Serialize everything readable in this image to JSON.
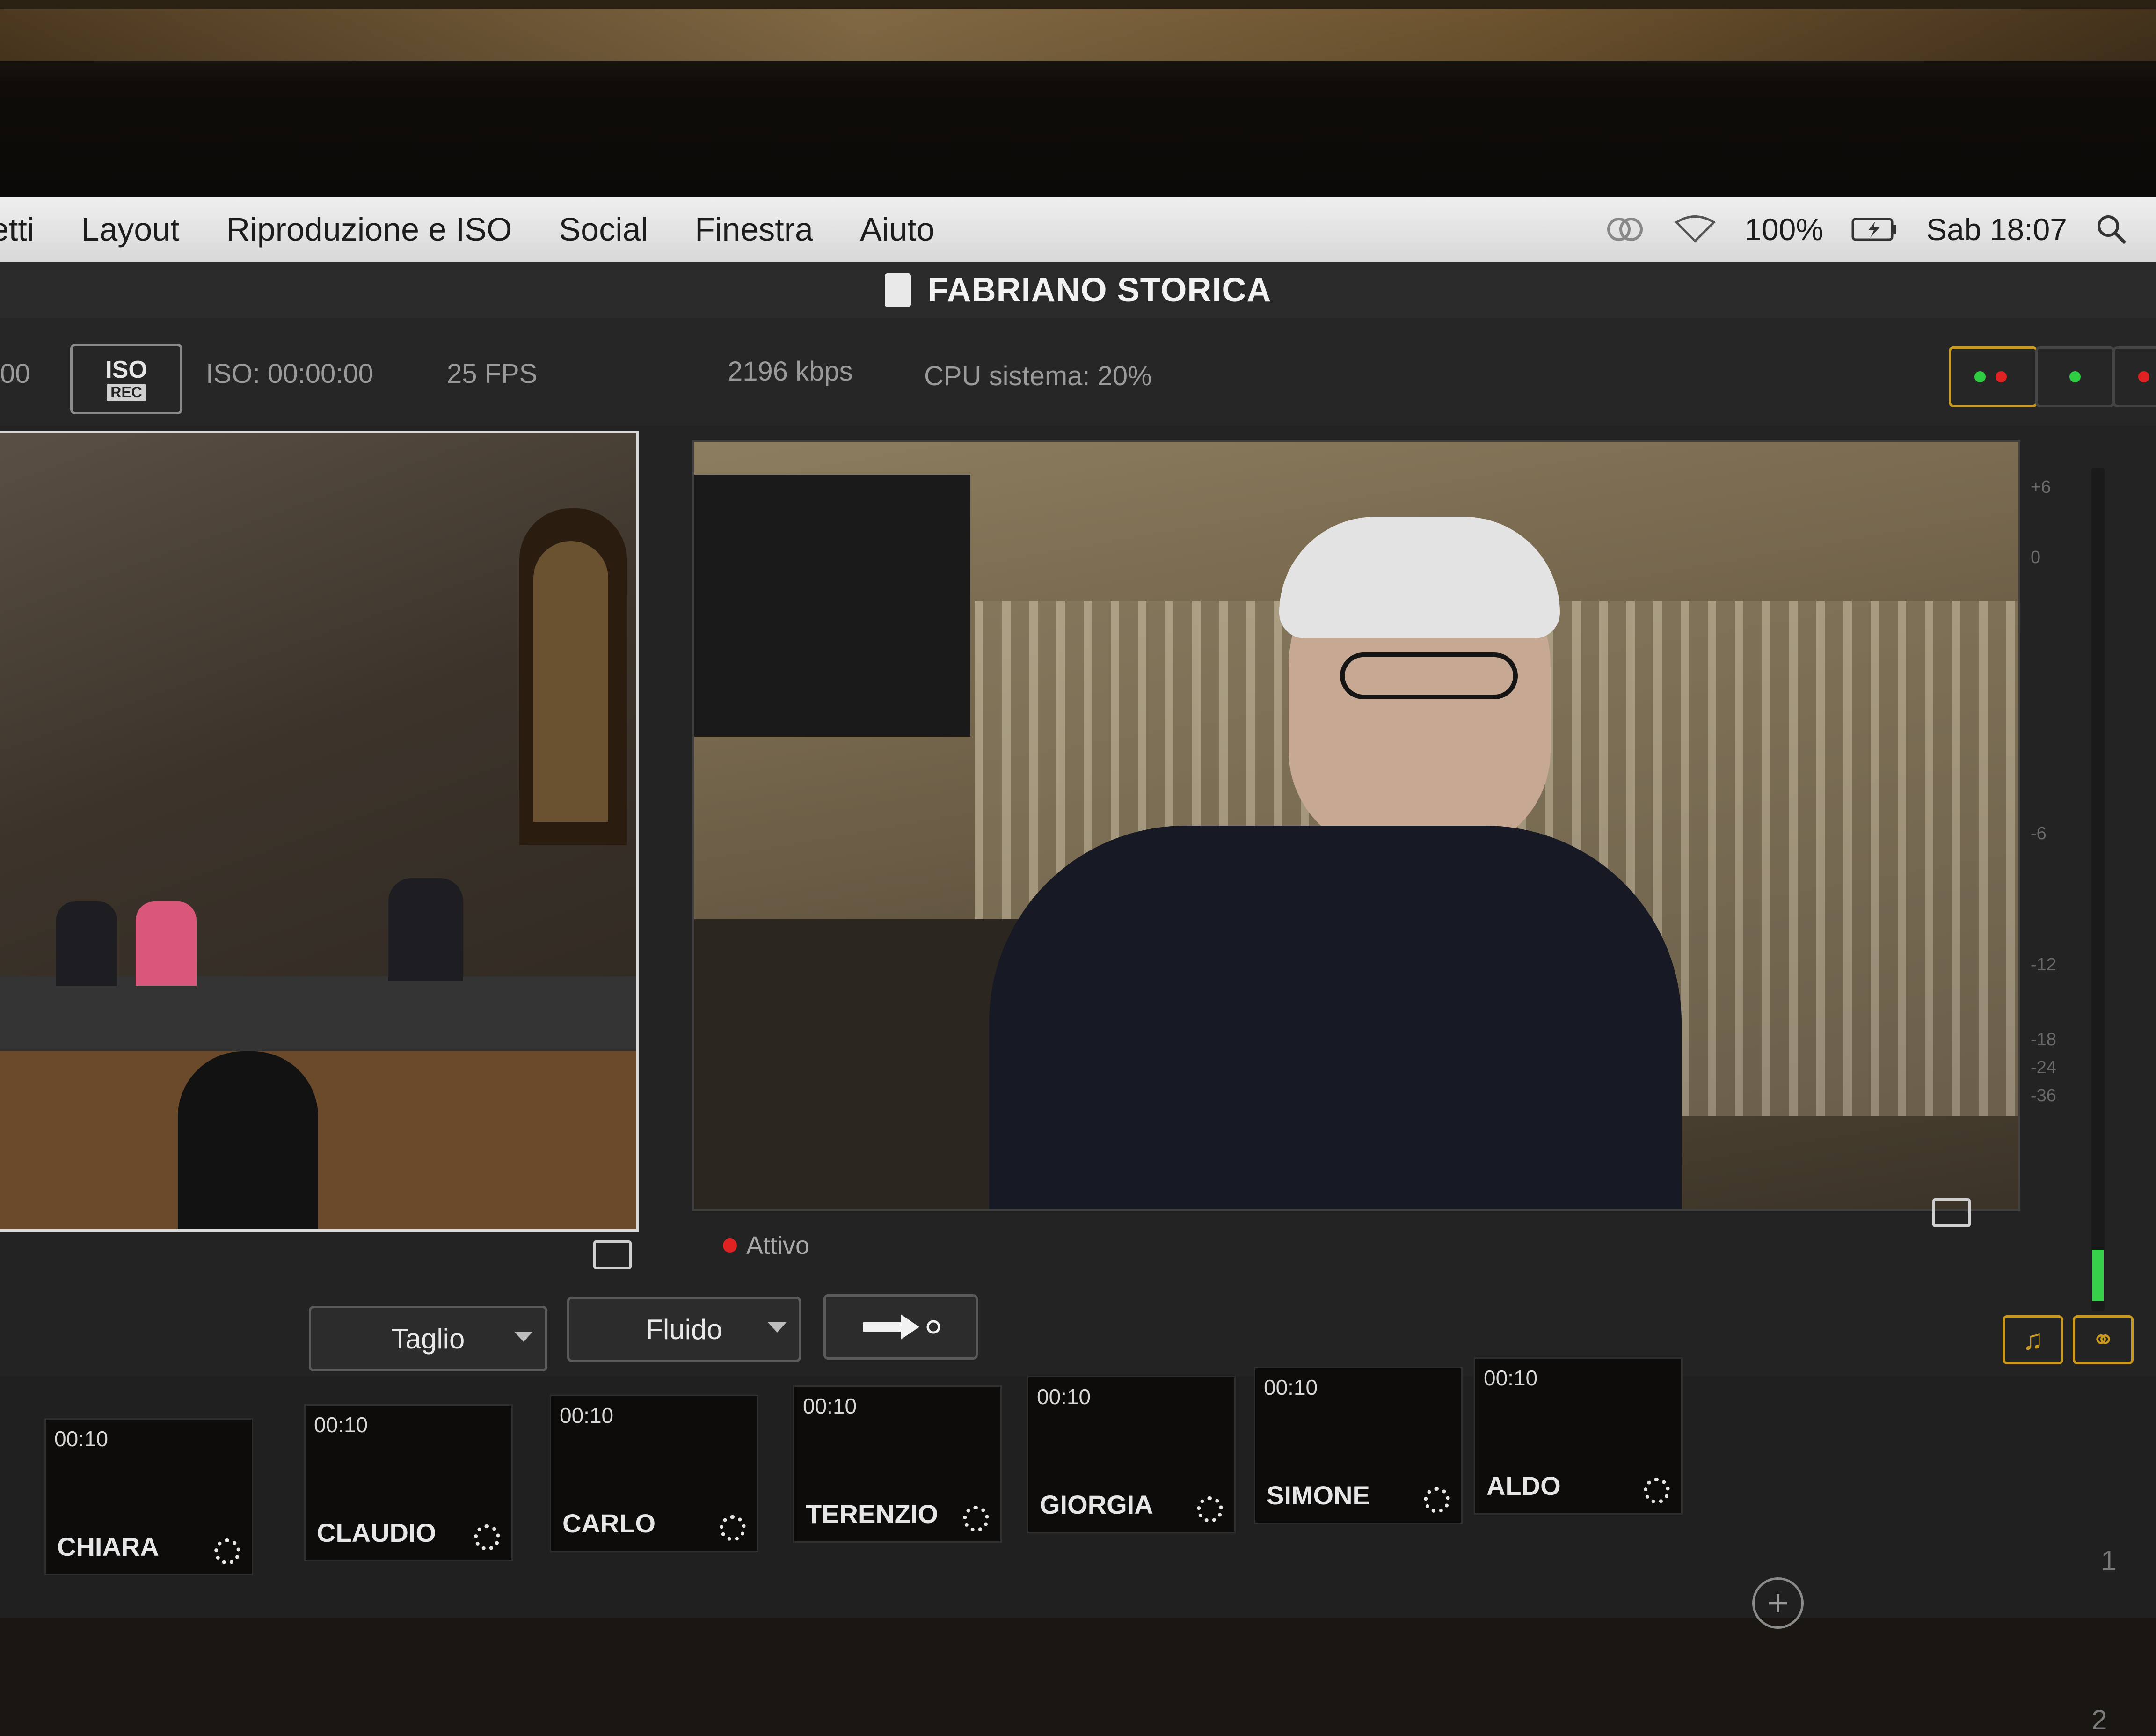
{
  "menubar": {
    "items": [
      "etti",
      "Layout",
      "Riproduzione e ISO",
      "Social",
      "Finestra",
      "Aiuto"
    ],
    "battery": "100%",
    "clock": "Sab 18:07"
  },
  "window": {
    "title": "FABRIANO STORICA"
  },
  "toolbar": {
    "left_clip": "00",
    "iso_label": "ISO",
    "rec_label": "REC",
    "iso_time": "ISO:  00:00:00",
    "fps": "25 FPS",
    "bitrate": "2196 kbps",
    "cpu": "CPU sistema: 20%"
  },
  "program": {
    "status": "Attivo"
  },
  "meter": {
    "ticks": [
      "+6",
      "0",
      "-6",
      "-12",
      "-18",
      "-24",
      "-36"
    ]
  },
  "transition": {
    "type": "Taglio",
    "effect": "Fluido",
    "go_icon": "arrow-right-icon"
  },
  "inputs": [
    {
      "name": "CHIARA",
      "time": "00:10"
    },
    {
      "name": "CLAUDIO",
      "time": "00:10"
    },
    {
      "name": "CARLO",
      "time": "00:10"
    },
    {
      "name": "TERENZIO",
      "time": "00:10"
    },
    {
      "name": "GIORGIA",
      "time": "00:10"
    },
    {
      "name": "SIMONE",
      "time": "00:10"
    },
    {
      "name": "ALDO",
      "time": "00:10"
    }
  ],
  "pages": [
    "1",
    "2"
  ],
  "colors": {
    "accent": "#c99a1f",
    "live": "#e02222",
    "meter_green": "#36d04a"
  }
}
